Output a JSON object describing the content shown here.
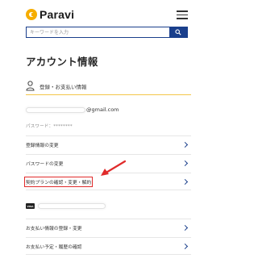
{
  "header": {
    "brand": "Paravi",
    "logo_icon": "paravi-logo-icon",
    "menu_icon": "hamburger-menu-icon"
  },
  "search": {
    "placeholder": "キーワードを入力",
    "button_icon": "search-icon"
  },
  "page": {
    "title": "アカウント情報"
  },
  "section": {
    "icon": "person-icon",
    "label": "登録・お支払い情報"
  },
  "account": {
    "email_domain": "@gmail.com",
    "password_label": "パスワード：********"
  },
  "links": [
    {
      "label": "登録情報の変更"
    },
    {
      "label": "パスワードの変更"
    },
    {
      "label": "契約プランの確認・変更・解約"
    },
    {
      "label": "お支払い情報の登録・変更"
    },
    {
      "label": "お支払い予定・履歴の確認"
    }
  ],
  "card": {
    "brand": "VISA"
  },
  "annotation": {
    "arrow_color": "#e02b2b",
    "highlight_color": "#e02b2b"
  },
  "colors": {
    "accent": "#1a3f8c",
    "section_underline": "#f3c64a",
    "logo": "#f6ad00"
  }
}
